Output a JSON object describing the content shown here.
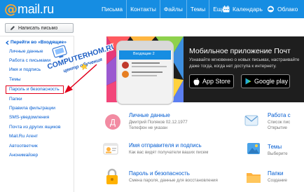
{
  "header": {
    "logo_at": "@",
    "logo_text": "mail.ru",
    "nav": [
      "Письма",
      "Контакты",
      "Файлы",
      "Темы",
      "Ещё"
    ],
    "calendar_label": "Календарь",
    "cloud_label": "Облако"
  },
  "compose": {
    "label": "Написать письмо"
  },
  "sidebar": {
    "back_label": "Перейти во «Входящие»",
    "items": [
      "Личные данные",
      "Работа с письмами",
      "Имя и подпись",
      "Темы",
      "Пароль и безопасность",
      "Папки",
      "Правила фильтрации",
      "SMS-уведомления",
      "Почта из других ящиков",
      "Mail.Ru Агент",
      "Автоответчик",
      "Анонимайзер"
    ]
  },
  "watermark": {
    "line1": "COMPUTERHOM.RU",
    "line2": "центр обучения"
  },
  "banner": {
    "title": "Мобильное приложение Почт",
    "desc_line1": "Узнавайте мгновенно о новых письмах, настраивайте",
    "desc_line2": "даже тогда, когда нет доступа к интернету.",
    "appstore_label": "App Store",
    "googleplay_label": "Google play",
    "phone_header": "Входящие 2"
  },
  "tiles": {
    "personal": {
      "title": "Личные данные",
      "desc1": "Дмитрий Поляков  02.12.1977",
      "desc2": "Телефон не указан",
      "icon_letter": "Д"
    },
    "signature": {
      "title": "Имя отправителя и подпись",
      "desc1": "Как вас видят получатели ваших писем"
    },
    "password": {
      "title": "Пароль и безопасность",
      "desc1": "Смена пароля, данные для восстановления"
    },
    "right_top": {
      "title": "Работа с",
      "desc1": "Список пис",
      "desc2": "Открытие"
    },
    "right_mid": {
      "title": "Темы",
      "desc1": "Выберите"
    },
    "right_bot": {
      "title": "Папки",
      "desc1": "Создание"
    }
  },
  "colors": {
    "topbar": "#168de2",
    "logo_at": "#ffa930",
    "link": "#005bd1",
    "highlight": "#e1001b",
    "banner_bg": "#1e1e1e"
  }
}
